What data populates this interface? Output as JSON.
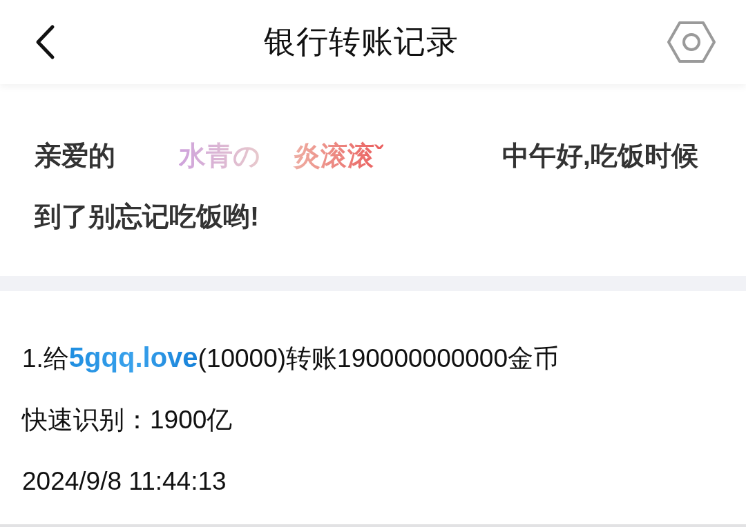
{
  "header": {
    "title": "银行转账记录"
  },
  "greeting": {
    "prefix": "亲爱的",
    "name_parts": [
      "水青の",
      "炎滚滚ˇ"
    ],
    "suffix": "中午好,吃饭时候到了别忘记吃饭哟!"
  },
  "records": [
    {
      "prefix": "1.给",
      "user": "5gqq.love",
      "suffix": "(10000)转账190000000000金币",
      "quick_label": "快速识别：",
      "quick_value": "1900亿",
      "time": "2024/9/8 11:44:13"
    }
  ]
}
